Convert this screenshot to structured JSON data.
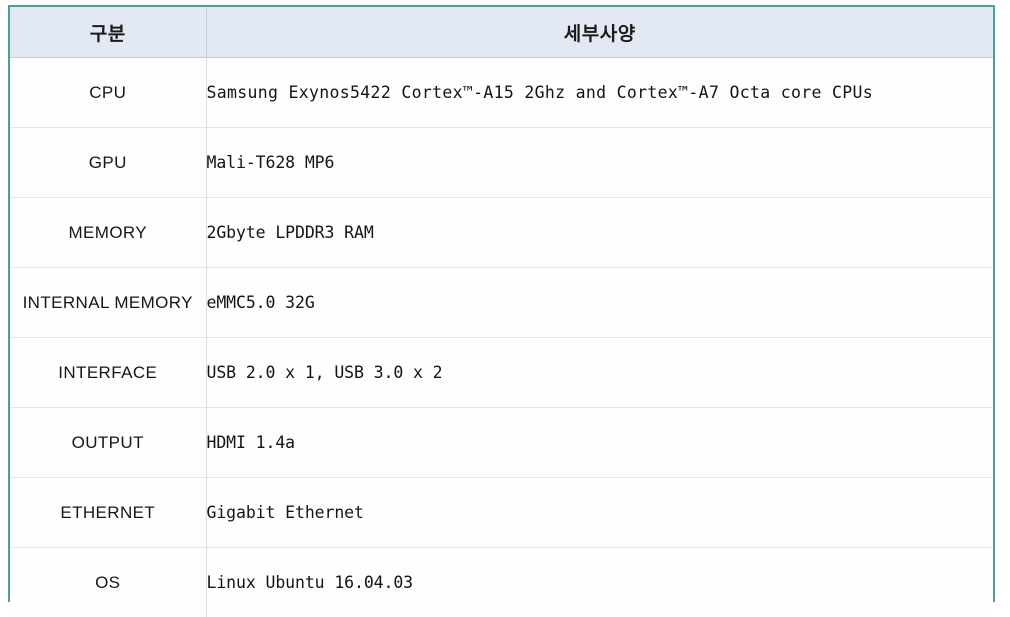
{
  "table": {
    "columns": [
      {
        "key": "category",
        "label": "구분"
      },
      {
        "key": "detail",
        "label": "세부사양"
      }
    ],
    "rows": [
      {
        "category": "CPU",
        "detail": "Samsung Exynos5422 Cortex™-A15 2Ghz and Cortex™-A7 Octa core CPUs"
      },
      {
        "category": "GPU",
        "detail": "Mali-T628 MP6"
      },
      {
        "category": "MEMORY",
        "detail": "2Gbyte LPDDR3 RAM"
      },
      {
        "category": "INTERNAL MEMORY",
        "detail": "eMMC5.0 32G"
      },
      {
        "category": "INTERFACE",
        "detail": "USB 2.0 x 1, USB 3.0 x 2"
      },
      {
        "category": "OUTPUT",
        "detail": "HDMI 1.4a"
      },
      {
        "category": "ETHERNET",
        "detail": "Gigabit Ethernet"
      },
      {
        "category": "OS",
        "detail": "Linux Ubuntu 16.04.03"
      }
    ]
  },
  "colors": {
    "frame_border": "#4d9f97",
    "header_background": "#e3e8f5",
    "row_separator": "#e6e6e6",
    "text": "#161616"
  }
}
